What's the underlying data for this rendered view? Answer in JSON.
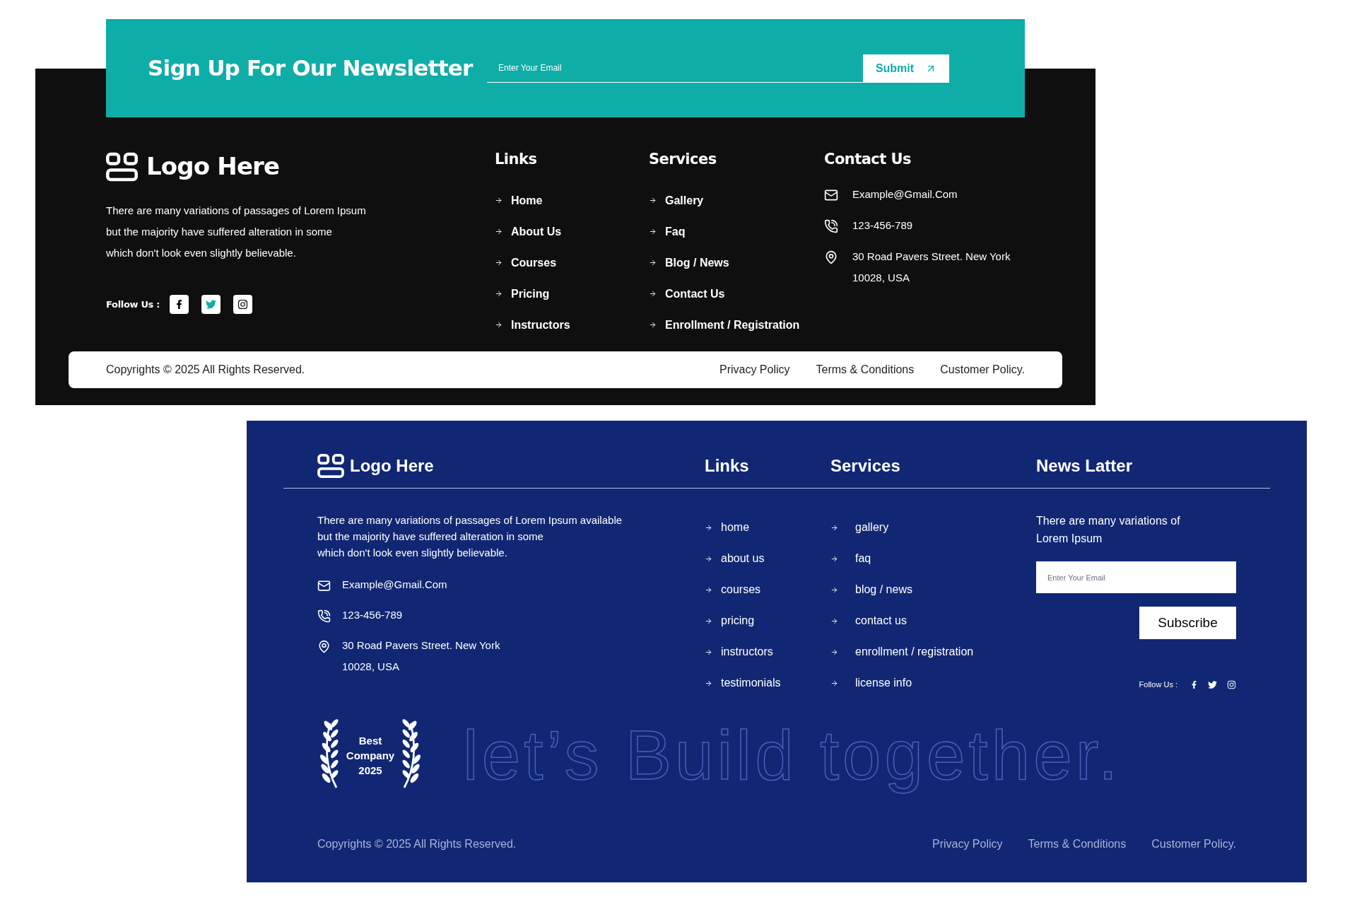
{
  "newsletter_banner": {
    "title": "Sign Up For Our Newsletter",
    "email_field": {
      "placeholder": "Enter Your Email"
    },
    "submit_button": "Submit"
  },
  "dark_footer": {
    "logo": "Logo Here",
    "description_lines": [
      "There are many variations of passages of Lorem Ipsum",
      "but the majority have suffered alteration in some",
      "which don't look even slightly believable."
    ],
    "follow_label": "Follow Us :",
    "links": {
      "heading": "Links",
      "items": [
        "Home",
        "About Us",
        "Courses",
        "Pricing",
        "Instructors"
      ]
    },
    "services": {
      "heading": "Services",
      "items": [
        "Gallery",
        "Faq",
        "Blog / News",
        "Contact Us",
        "Enrollment / Registration"
      ]
    },
    "contact": {
      "heading": "Contact Us",
      "items": [
        {
          "kind": "email",
          "lines": [
            "Example@Gmail.Com"
          ]
        },
        {
          "kind": "phone",
          "lines": [
            "123-456-789"
          ]
        },
        {
          "kind": "address",
          "lines": [
            "30 Road Pavers Street. New York",
            "10028, USA"
          ]
        }
      ]
    },
    "bottom_bar": {
      "copyright": "Copyrights © 2025  All Rights Reserved.",
      "links": [
        "Privacy Policy",
        "Terms & Conditions",
        "Customer Policy."
      ]
    }
  },
  "blue_footer": {
    "logo": "Logo Here",
    "description_lines": [
      "There are many variations of passages of Lorem Ipsum available",
      "but the majority have suffered alteration in some",
      "which don't look even slightly believable."
    ],
    "contact": [
      {
        "kind": "email",
        "lines": [
          "Example@Gmail.Com"
        ]
      },
      {
        "kind": "phone",
        "lines": [
          "123-456-789"
        ]
      },
      {
        "kind": "address",
        "lines": [
          "30 Road Pavers Street. New York",
          "10028, USA"
        ]
      }
    ],
    "award": [
      "Best",
      "Company",
      "2025"
    ],
    "links": {
      "heading": "Links",
      "items": [
        "home",
        "about us",
        "courses",
        "pricing",
        "instructors",
        "testimonials"
      ]
    },
    "services": {
      "heading": "Services",
      "items": [
        "gallery",
        "faq",
        "blog / news",
        "contact us",
        "enrollment / registration",
        "license info"
      ]
    },
    "newsletter": {
      "heading": "News Latter",
      "text_lines": [
        "There are many variations of",
        "Lorem Ipsum"
      ],
      "email_field": {
        "placeholder": "Enter Your Email"
      },
      "subscribe_button": "Subscribe",
      "follow_label": "Follow Us :"
    },
    "slogan": "let’s Build together.",
    "copyright": "Copyrights © 2025  All Rights Reserved.",
    "policy_links": [
      "Privacy Policy",
      "Terms & Conditions",
      "Customer Policy."
    ]
  }
}
